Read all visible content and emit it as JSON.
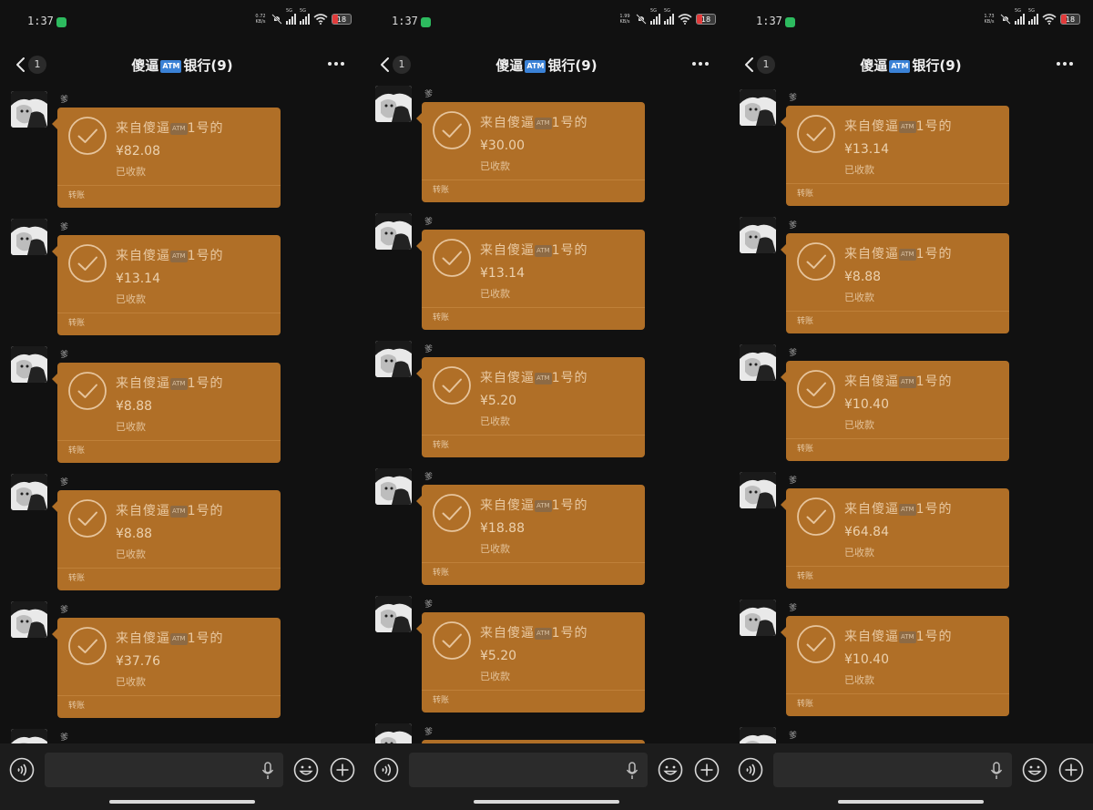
{
  "panels": [
    {
      "status": {
        "time": "1:37",
        "net_speed_value": "0.72",
        "net_speed_unit": "KB/s",
        "signal_label_1": "5G",
        "signal_label_2": "5G",
        "battery": "18"
      },
      "header": {
        "unread_count": "1",
        "title_prefix": "傻逼",
        "title_badge": "ATM",
        "title_suffix": "银行(9)"
      },
      "messages": [
        {
          "sender": "爹",
          "desc_prefix": "来自傻逼",
          "desc_badge": "ATM",
          "desc_suffix": "1号的",
          "amount": "¥82.08",
          "status": "已收款",
          "type": "转账"
        },
        {
          "sender": "爹",
          "desc_prefix": "来自傻逼",
          "desc_badge": "ATM",
          "desc_suffix": "1号的",
          "amount": "¥13.14",
          "status": "已收款",
          "type": "转账"
        },
        {
          "sender": "爹",
          "desc_prefix": "来自傻逼",
          "desc_badge": "ATM",
          "desc_suffix": "1号的",
          "amount": "¥8.88",
          "status": "已收款",
          "type": "转账"
        },
        {
          "sender": "爹",
          "desc_prefix": "来自傻逼",
          "desc_badge": "ATM",
          "desc_suffix": "1号的",
          "amount": "¥8.88",
          "status": "已收款",
          "type": "转账"
        },
        {
          "sender": "爹",
          "desc_prefix": "来自傻逼",
          "desc_badge": "ATM",
          "desc_suffix": "1号的",
          "amount": "¥37.76",
          "status": "已收款",
          "type": "转账"
        },
        {
          "sender": "爹",
          "desc_prefix": "",
          "desc_badge": "",
          "desc_suffix": "",
          "amount": "",
          "status": "",
          "type": ""
        }
      ]
    },
    {
      "status": {
        "time": "1:37",
        "net_speed_value": "1.99",
        "net_speed_unit": "KB/s",
        "signal_label_1": "5G",
        "signal_label_2": "5G",
        "battery": "18"
      },
      "header": {
        "unread_count": "1",
        "title_prefix": "傻逼",
        "title_badge": "ATM",
        "title_suffix": "银行(9)"
      },
      "messages": [
        {
          "sender": "爹",
          "desc_prefix": "来自傻逼",
          "desc_badge": "ATM",
          "desc_suffix": "1号的",
          "amount": "¥30.00",
          "status": "已收款",
          "type": "转账"
        },
        {
          "sender": "爹",
          "desc_prefix": "来自傻逼",
          "desc_badge": "ATM",
          "desc_suffix": "1号的",
          "amount": "¥13.14",
          "status": "已收款",
          "type": "转账"
        },
        {
          "sender": "爹",
          "desc_prefix": "来自傻逼",
          "desc_badge": "ATM",
          "desc_suffix": "1号的",
          "amount": "¥5.20",
          "status": "已收款",
          "type": "转账"
        },
        {
          "sender": "爹",
          "desc_prefix": "来自傻逼",
          "desc_badge": "ATM",
          "desc_suffix": "1号的",
          "amount": "¥18.88",
          "status": "已收款",
          "type": "转账"
        },
        {
          "sender": "爹",
          "desc_prefix": "来自傻逼",
          "desc_badge": "ATM",
          "desc_suffix": "1号的",
          "amount": "¥5.20",
          "status": "已收款",
          "type": "转账"
        },
        {
          "sender": "爹",
          "desc_prefix": "",
          "desc_badge": "",
          "desc_suffix": "",
          "amount": "",
          "status": "",
          "type": ""
        }
      ]
    },
    {
      "status": {
        "time": "1:37",
        "net_speed_value": "1.73",
        "net_speed_unit": "KB/s",
        "signal_label_1": "5G",
        "signal_label_2": "5G",
        "battery": "18"
      },
      "header": {
        "unread_count": "1",
        "title_prefix": "傻逼",
        "title_badge": "ATM",
        "title_suffix": "银行(9)"
      },
      "messages": [
        {
          "sender": "爹",
          "desc_prefix": "来自傻逼",
          "desc_badge": "ATM",
          "desc_suffix": "1号的",
          "amount": "¥13.14",
          "status": "已收款",
          "type": "转账"
        },
        {
          "sender": "爹",
          "desc_prefix": "来自傻逼",
          "desc_badge": "ATM",
          "desc_suffix": "1号的",
          "amount": "¥8.88",
          "status": "已收款",
          "type": "转账"
        },
        {
          "sender": "爹",
          "desc_prefix": "来自傻逼",
          "desc_badge": "ATM",
          "desc_suffix": "1号的",
          "amount": "¥10.40",
          "status": "已收款",
          "type": "转账"
        },
        {
          "sender": "爹",
          "desc_prefix": "来自傻逼",
          "desc_badge": "ATM",
          "desc_suffix": "1号的",
          "amount": "¥64.84",
          "status": "已收款",
          "type": "转账"
        },
        {
          "sender": "爹",
          "desc_prefix": "来自傻逼",
          "desc_badge": "ATM",
          "desc_suffix": "1号的",
          "amount": "¥10.40",
          "status": "已收款",
          "type": "转账"
        },
        {
          "sender": "爹",
          "desc_prefix": "",
          "desc_badge": "",
          "desc_suffix": "",
          "amount": "",
          "status": "",
          "type": ""
        }
      ]
    }
  ],
  "theme": {
    "background": "#111111",
    "card_color": "#b06f27",
    "input_bar": "#1c1c1c"
  },
  "icons": {
    "back": "chevron-left-icon",
    "more": "more-dots-icon",
    "check": "check-circle-icon",
    "voice": "voice-icon",
    "mic": "mic-icon",
    "emoji": "emoji-icon",
    "plus": "plus-circle-icon"
  }
}
